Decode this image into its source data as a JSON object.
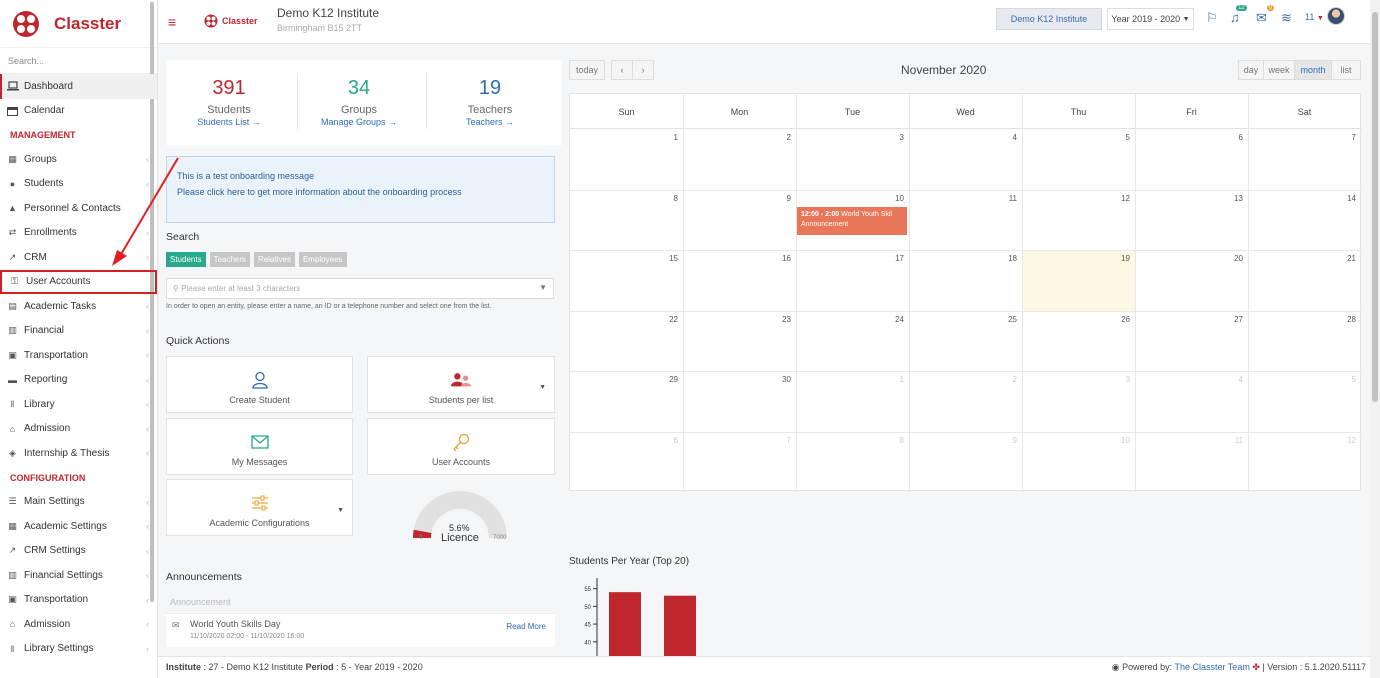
{
  "sidebar": {
    "logo_text": "Classter",
    "search_placeholder": "Search...",
    "items": [
      {
        "label": "Dashboard",
        "icon": "laptop-icon"
      },
      {
        "label": "Calendar",
        "icon": "calendar-icon"
      }
    ],
    "management_label": "MANAGEMENT",
    "management_items": [
      {
        "label": "Groups"
      },
      {
        "label": "Students"
      },
      {
        "label": "Personnel & Contacts"
      },
      {
        "label": "Enrollments"
      },
      {
        "label": "CRM"
      },
      {
        "label": "User Accounts"
      },
      {
        "label": "Academic Tasks"
      },
      {
        "label": "Financial"
      },
      {
        "label": "Transportation"
      },
      {
        "label": "Reporting"
      },
      {
        "label": "Library"
      },
      {
        "label": "Admission"
      },
      {
        "label": "Internship & Thesis"
      }
    ],
    "configuration_label": "CONFIGURATION",
    "configuration_items": [
      {
        "label": "Main Settings"
      },
      {
        "label": "Academic Settings"
      },
      {
        "label": "CRM Settings"
      },
      {
        "label": "Financial Settings"
      },
      {
        "label": "Transportation"
      },
      {
        "label": "Admission"
      },
      {
        "label": "Library Settings"
      }
    ]
  },
  "topbar": {
    "logo_text": "Classter",
    "institute_name": "Demo K12 Institute",
    "institute_address": "Birmingham B15 2TT",
    "institute_button": "Demo K12 Institute",
    "year_button": "Year 2019 - 2020",
    "notif_count": "12",
    "msg_count": "0",
    "user_count": "11"
  },
  "stats": [
    {
      "number": "391",
      "label": "Students",
      "link": "Students List →",
      "color": "#c0262d"
    },
    {
      "number": "34",
      "label": "Groups",
      "link": "Manage Groups →",
      "color": "#28a98b"
    },
    {
      "number": "19",
      "label": "Teachers",
      "link": "Teachers →",
      "color": "#2e6cb5"
    }
  ],
  "onboarding": {
    "line1": "This is a test onboarding message",
    "line2": "Please click here to get more information about the onboarding process"
  },
  "search": {
    "title": "Search",
    "tabs": [
      "Students",
      "Teachers",
      "Relatives",
      "Employees"
    ],
    "placeholder": "Please enter at least 3 characters",
    "help": "In order to open an entity, please enter a name, an ID or a telephone number and select one from the list."
  },
  "quick_actions": {
    "title": "Quick Actions",
    "create_student": "Create Student",
    "students_per_list": "Students per list",
    "my_messages": "My Messages",
    "user_accounts": "User Accounts",
    "academic_configurations": "Academic Configurations"
  },
  "licence_gauge": {
    "percent_text": "5.6%",
    "label": "Licence",
    "min": "0",
    "max": "7000",
    "value": 391,
    "max_value": 7000,
    "color": "#c0262d"
  },
  "announcements": {
    "title": "Announcements",
    "subtitle": "Announcement",
    "item_title": "World Youth Skills Day",
    "item_dates": "11/10/2020 02:00 - 11/10/2020 16:00",
    "read_more": "Read More"
  },
  "calendar": {
    "title": "November 2020",
    "today_btn": "today",
    "prev": "‹",
    "next": "›",
    "views": [
      "day",
      "week",
      "month",
      "list"
    ],
    "active_view": "month",
    "weekdays": [
      "Sun",
      "Mon",
      "Tue",
      "Wed",
      "Thu",
      "Fri",
      "Sat"
    ],
    "weeks": [
      [
        "1",
        "2",
        "3",
        "4",
        "5",
        "6",
        "7"
      ],
      [
        "8",
        "9",
        "10",
        "11",
        "12",
        "13",
        "14"
      ],
      [
        "15",
        "16",
        "17",
        "18",
        "19",
        "20",
        "21"
      ],
      [
        "22",
        "23",
        "24",
        "25",
        "26",
        "27",
        "28"
      ],
      [
        "29",
        "30",
        "1",
        "2",
        "3",
        "4",
        "5"
      ],
      [
        "6",
        "7",
        "8",
        "9",
        "10",
        "11",
        "12"
      ]
    ],
    "event_time": "12:00 - 2:00",
    "event_title": "World Youth Skil",
    "event_sub": "Announcement"
  },
  "chart_data": {
    "type": "bar",
    "title": "Students Per Year (Top 20)",
    "categories": [
      "",
      ""
    ],
    "values": [
      54,
      53
    ],
    "yticks": [
      40,
      45,
      50,
      55
    ],
    "ylim": [
      36,
      58
    ],
    "color": "#c0262d"
  },
  "footer": {
    "institute_label": "Institute",
    "institute_value": ": 27 - Demo K12 Institute",
    "period_label": "Period",
    "period_value": ": 5 - Year 2019 - 2020",
    "powered": "Powered by:",
    "team": "The Classter Team",
    "version": "| Version : 5.1.2020.51117"
  }
}
